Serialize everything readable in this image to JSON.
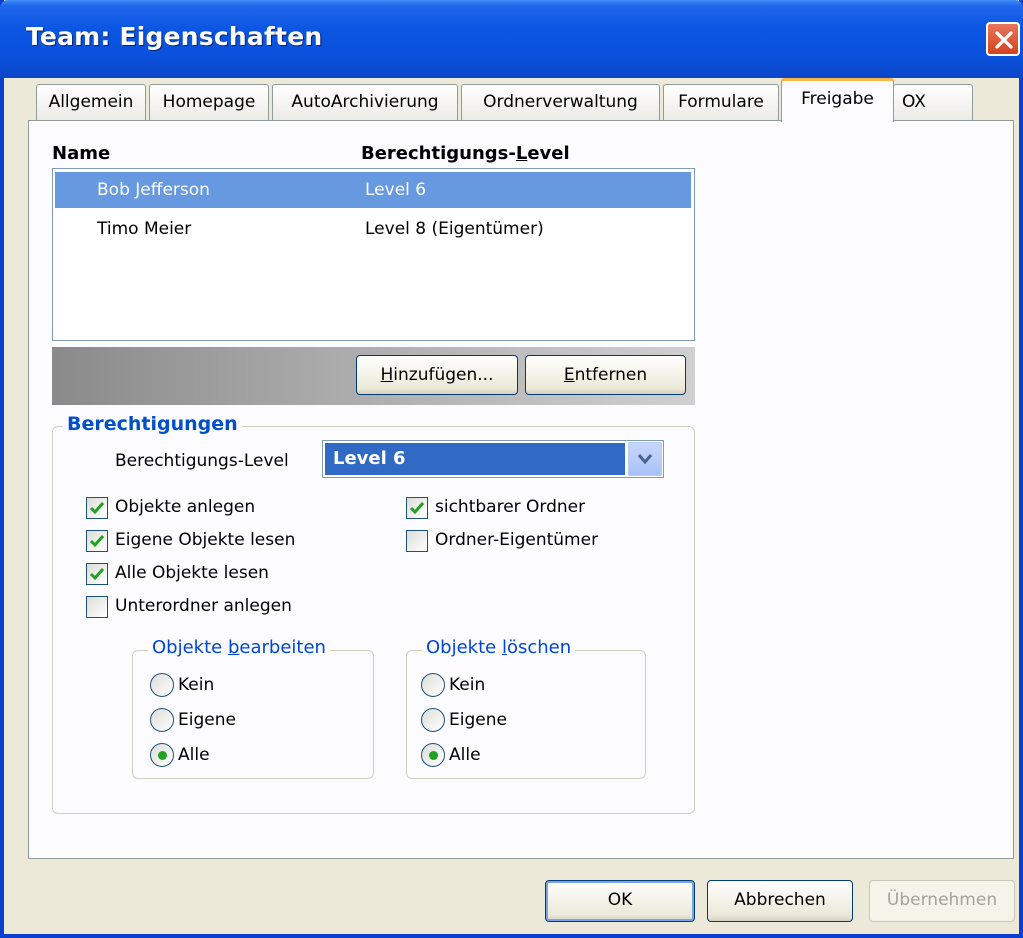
{
  "window": {
    "title": "Team: Eigenschaften"
  },
  "tabs": [
    {
      "label": "Allgemein"
    },
    {
      "label": "Homepage"
    },
    {
      "label": "AutoArchivierung"
    },
    {
      "label": "Ordnerverwaltung"
    },
    {
      "label": "Formulare"
    },
    {
      "label": "Freigabe",
      "active": true
    },
    {
      "label": "OX"
    }
  ],
  "permissions_list": {
    "col_name": "Name",
    "col_level_pre": "Berechtigungs-",
    "col_level_key": "L",
    "col_level_post": "evel",
    "rows": [
      {
        "name": "Bob Jefferson",
        "level": "Level 6",
        "selected": true
      },
      {
        "name": "Timo Meier",
        "level": "Level 8 (Eigentümer)",
        "selected": false
      }
    ]
  },
  "buttons": {
    "add_key": "H",
    "add_rest": "inzufügen...",
    "remove_key": "E",
    "remove_rest": "ntfernen",
    "ok": "OK",
    "cancel": "Abbrechen",
    "apply": "Übernehmen"
  },
  "permissions": {
    "legend": "Berechtigungen",
    "level_label": "Berechtigungs-Level",
    "level_value": "Level 6",
    "checkboxes": [
      {
        "label": "Objekte anlegen",
        "checked": true
      },
      {
        "label": "Eigene Objekte lesen",
        "checked": true
      },
      {
        "label": "Alle Objekte lesen",
        "checked": true
      },
      {
        "label": "Unterordner anlegen",
        "checked": false
      },
      {
        "label": "sichtbarer Ordner",
        "checked": true
      },
      {
        "label": "Ordner-Eigentümer",
        "checked": false
      }
    ],
    "edit_group": {
      "legend_pre": "Objekte ",
      "legend_key": "b",
      "legend_post": "earbeiten",
      "options": [
        {
          "label": "Kein",
          "checked": false
        },
        {
          "label": "Eigene",
          "checked": false
        },
        {
          "label": "Alle",
          "checked": true
        }
      ]
    },
    "delete_group": {
      "legend_pre": "Objekte ",
      "legend_key": "l",
      "legend_post": "öschen",
      "options": [
        {
          "label": "Kein",
          "checked": false
        },
        {
          "label": "Eigene",
          "checked": false
        },
        {
          "label": "Alle",
          "checked": true
        }
      ]
    }
  },
  "colors": {
    "titlebar": "#0a54e2",
    "selection": "#6699e0",
    "accent_tab": "#f7b645",
    "group_title": "#0046d5"
  }
}
